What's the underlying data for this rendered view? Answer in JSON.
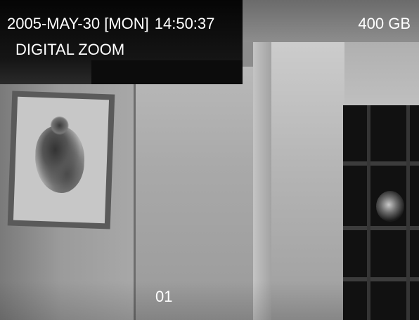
{
  "osd": {
    "date": "2005-MAY-30 [MON]",
    "time": "14:50:37",
    "storage_capacity": "400 GB",
    "mode": "DIGITAL ZOOM",
    "channel": "01"
  },
  "colors": {
    "osd_text": "#ffffff"
  }
}
